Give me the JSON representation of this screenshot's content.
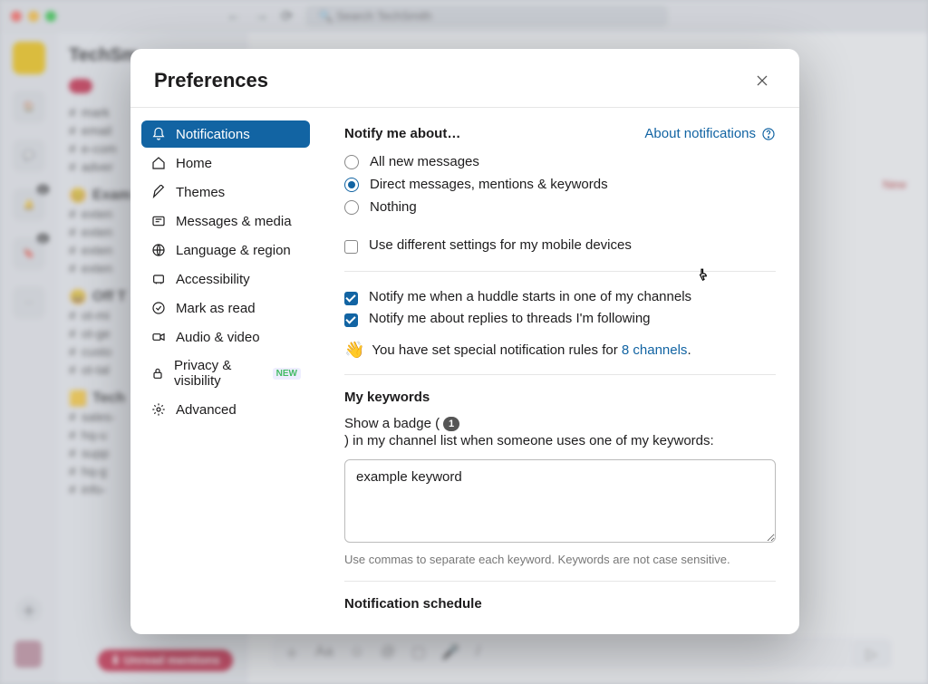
{
  "bg": {
    "search_placeholder": "Search TechSmith",
    "workspace": "TechSm",
    "rail": [
      "Home",
      "DMs",
      "Activity",
      "Later",
      "More"
    ],
    "channels_top": [
      "mark",
      "email",
      "e-com",
      "adver"
    ],
    "section1": "Exam",
    "channels_mid": [
      "exten",
      "exten",
      "exten",
      "exten"
    ],
    "section2": "Off T",
    "channels_mid2": [
      "ot-mi",
      "ot-ge",
      "custo",
      "ot-tal"
    ],
    "section3": "Tech",
    "channels_bot": [
      "sales-",
      "hq-u",
      "supp",
      "hq-g",
      "info-"
    ],
    "unread": "Unread mentions",
    "new": "New"
  },
  "modal": {
    "title": "Preferences",
    "sidebar": [
      {
        "key": "notifications",
        "label": "Notifications",
        "active": true
      },
      {
        "key": "home",
        "label": "Home"
      },
      {
        "key": "themes",
        "label": "Themes"
      },
      {
        "key": "messages",
        "label": "Messages & media"
      },
      {
        "key": "language",
        "label": "Language & region"
      },
      {
        "key": "accessibility",
        "label": "Accessibility"
      },
      {
        "key": "markread",
        "label": "Mark as read"
      },
      {
        "key": "av",
        "label": "Audio & video"
      },
      {
        "key": "privacy",
        "label": "Privacy & visibility",
        "badge": "NEW"
      },
      {
        "key": "advanced",
        "label": "Advanced"
      }
    ],
    "content": {
      "notify_heading": "Notify me about…",
      "about_link": "About notifications",
      "radio_all": "All new messages",
      "radio_direct": "Direct messages, mentions & keywords",
      "radio_nothing": "Nothing",
      "mobile_check": "Use different settings for my mobile devices",
      "huddle_check": "Notify me when a huddle starts in one of my channels",
      "thread_check": "Notify me about replies to threads I'm following",
      "wave": "👋",
      "special_prefix": "You have set special notification rules for ",
      "special_link": "8 channels",
      "special_suffix": ".",
      "keywords_heading": "My keywords",
      "keywords_desc_pre": "Show a badge (",
      "keywords_badge": "1",
      "keywords_desc_post": ") in my channel list when someone uses one of my keywords:",
      "keywords_value": "example keyword",
      "keywords_hint": "Use commas to separate each keyword. Keywords are not case sensitive.",
      "schedule_heading": "Notification schedule"
    }
  }
}
